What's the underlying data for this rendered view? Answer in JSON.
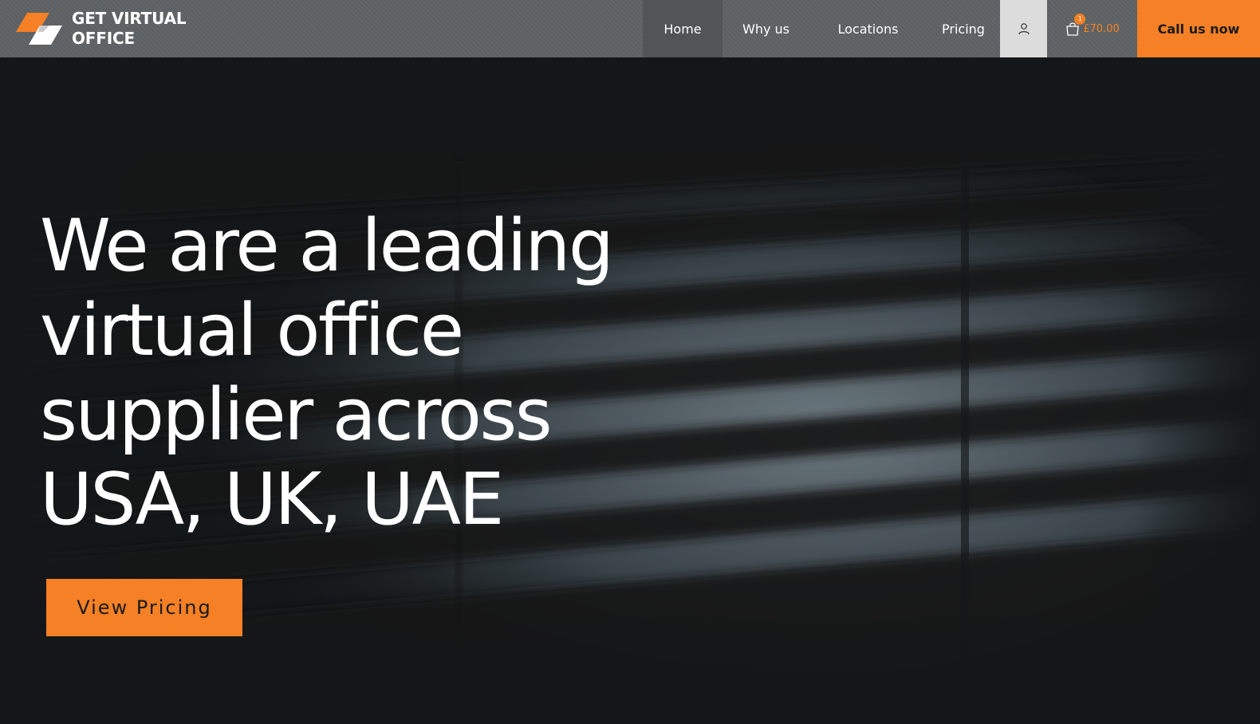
{
  "brand": {
    "name_line1": "GET VIRTUAL",
    "name_line2": "OFFICE",
    "logo_icon": "parallelogram-logo-icon",
    "accent_color": "#f58025",
    "logo_secondary_color": "#ffffff"
  },
  "nav": {
    "items": [
      {
        "label": "Home",
        "active": true
      },
      {
        "label": "Why us",
        "active": false
      },
      {
        "label": "Locations",
        "active": false
      },
      {
        "label": "Pricing",
        "active": false
      }
    ],
    "user_icon": "user-icon",
    "cart": {
      "icon": "shopping-bag-icon",
      "count": "1",
      "total": "£70.00"
    },
    "cta_label": "Call us now"
  },
  "hero": {
    "title_lines": [
      "We are a leading",
      "virtual office",
      "supplier across",
      "USA, UK, UAE"
    ],
    "button_label": "View Pricing",
    "background": "dark wall with window-blind shadow stripes"
  },
  "colors": {
    "header_bg": "#5e6264",
    "header_active_bg": "#515557",
    "user_button_bg": "#dcdcdc",
    "hero_bg": "#141719",
    "text_light": "#ffffff",
    "cta_text": "#1a1a1a"
  }
}
